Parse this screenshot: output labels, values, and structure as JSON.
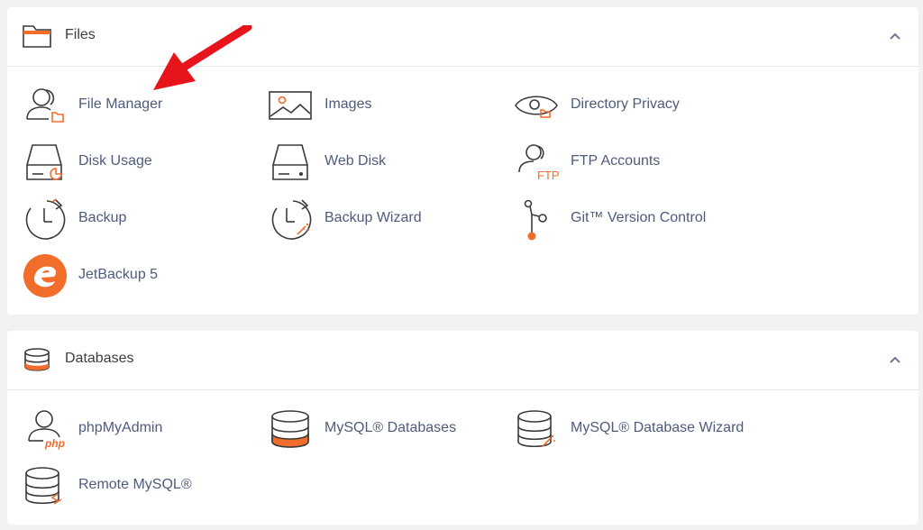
{
  "files": {
    "title": "Files",
    "items": [
      {
        "label": "File Manager",
        "icon": "file-manager-icon"
      },
      {
        "label": "Images",
        "icon": "images-icon"
      },
      {
        "label": "Directory Privacy",
        "icon": "directory-privacy-icon"
      },
      {
        "label": "Disk Usage",
        "icon": "disk-usage-icon"
      },
      {
        "label": "Web Disk",
        "icon": "web-disk-icon"
      },
      {
        "label": "FTP Accounts",
        "icon": "ftp-accounts-icon"
      },
      {
        "label": "Backup",
        "icon": "backup-icon"
      },
      {
        "label": "Backup Wizard",
        "icon": "backup-wizard-icon"
      },
      {
        "label": "Git™ Version Control",
        "icon": "git-icon"
      },
      {
        "label": "JetBackup 5",
        "icon": "jetbackup-icon"
      }
    ],
    "ftp_icon_text": "FTP"
  },
  "databases": {
    "title": "Databases",
    "items": [
      {
        "label": "phpMyAdmin",
        "icon": "phpmyadmin-icon"
      },
      {
        "label": "MySQL® Databases",
        "icon": "mysql-databases-icon"
      },
      {
        "label": "MySQL® Database Wizard",
        "icon": "mysql-wizard-icon"
      },
      {
        "label": "Remote MySQL®",
        "icon": "remote-mysql-icon"
      }
    ],
    "php_icon_text": "php"
  },
  "colors": {
    "accent": "#f26d2b",
    "link": "#4f5b7d",
    "arrow": "#e8141b",
    "icon_stroke": "#3a3a3a"
  }
}
